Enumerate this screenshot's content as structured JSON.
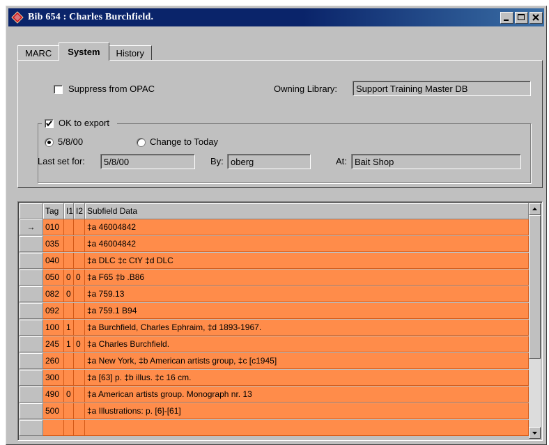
{
  "window": {
    "title": "Bib 654 : Charles Burchfield."
  },
  "tabs": [
    {
      "label": "MARC"
    },
    {
      "label": "System"
    },
    {
      "label": "History"
    }
  ],
  "system": {
    "suppress_label": "Suppress from OPAC",
    "suppress_checked": false,
    "owning_library_label": "Owning Library:",
    "owning_library_value": "Support Training Master DB",
    "ok_export_label": "OK to export",
    "ok_export_checked": true,
    "radio_date_label": "5/8/00",
    "radio_today_label": "Change to Today",
    "last_set_label": "Last set for:",
    "last_set_value": "5/8/00",
    "by_label": "By:",
    "by_value": "oberg",
    "at_label": "At:",
    "at_value": "Bait Shop"
  },
  "grid": {
    "headers": {
      "tag": "Tag",
      "i1": "I1",
      "i2": "I2",
      "data": "Subfield Data"
    },
    "current_indicator": "→",
    "rows": [
      {
        "tag": "010",
        "i1": "",
        "i2": "",
        "data": "‡a    46004842"
      },
      {
        "tag": "035",
        "i1": "",
        "i2": "",
        "data": "‡a 46004842"
      },
      {
        "tag": "040",
        "i1": "",
        "i2": "",
        "data": "‡a DLC ‡c CtY ‡d DLC"
      },
      {
        "tag": "050",
        "i1": "0",
        "i2": "0",
        "data": "‡a F65 ‡b .B86"
      },
      {
        "tag": "082",
        "i1": "0",
        "i2": "",
        "data": "‡a 759.13"
      },
      {
        "tag": "092",
        "i1": "",
        "i2": "",
        "data": "‡a 759.1 B94"
      },
      {
        "tag": "100",
        "i1": "1",
        "i2": "",
        "data": "‡a Burchfield, Charles Ephraim, ‡d 1893-1967."
      },
      {
        "tag": "245",
        "i1": "1",
        "i2": "0",
        "data": "‡a Charles Burchfield."
      },
      {
        "tag": "260",
        "i1": "",
        "i2": "",
        "data": "‡a New York, ‡b American artists group, ‡c [c1945]"
      },
      {
        "tag": "300",
        "i1": "",
        "i2": "",
        "data": "‡a [63] p. ‡b illus. ‡c 16 cm."
      },
      {
        "tag": "490",
        "i1": "0",
        "i2": "",
        "data": "‡a American artists group. Monograph nr. 13"
      },
      {
        "tag": "500",
        "i1": "",
        "i2": "",
        "data": "‡a Illustrations: p. [6]-[61]"
      },
      {
        "tag": "",
        "i1": "",
        "i2": "",
        "data": ""
      }
    ]
  },
  "colors": {
    "row_highlight": "#ff8c4a",
    "titlebar": "#0a246a",
    "face": "#c0c0c0"
  },
  "icons": {
    "app": "red-diamond-icon",
    "minimize": "minimize-icon",
    "maximize": "maximize-icon",
    "close": "close-icon"
  }
}
